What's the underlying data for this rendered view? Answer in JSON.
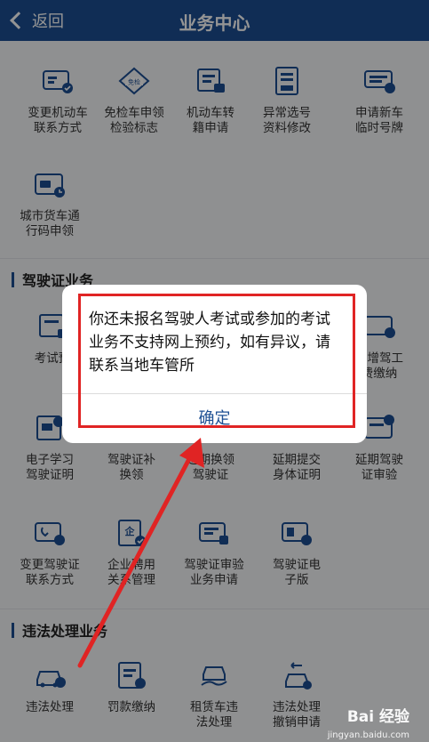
{
  "header": {
    "back_label": "返回",
    "title": "业务中心"
  },
  "vehicle": {
    "tiles": [
      {
        "l1": "变更机动车",
        "l2": "联系方式",
        "icon": "card-contact-icon"
      },
      {
        "l1": "免检车申领",
        "l2": "检验标志",
        "icon": "exempt-badge-icon",
        "badge": "免检"
      },
      {
        "l1": "机动车转",
        "l2": "籍申请",
        "icon": "vehicle-transfer-icon"
      },
      {
        "l1": "异常选号",
        "l2": "资料修改",
        "icon": "number-edit-icon"
      },
      {
        "l1": "申请新车",
        "l2": "临时号牌",
        "icon": "temp-plate-icon"
      },
      {
        "l1": "城市货车通",
        "l2": "行码申领",
        "icon": "truck-pass-icon"
      }
    ]
  },
  "license": {
    "title": "驾驶证业务",
    "tiles": [
      {
        "l1": "考试预",
        "l2": "",
        "icon": "exam-icon"
      },
      {
        "l1": "",
        "l2": "",
        "icon": "hidden-icon"
      },
      {
        "l1": "",
        "l2": "",
        "icon": "hidden-icon"
      },
      {
        "l1": "",
        "l2": "",
        "icon": "hidden-icon"
      },
      {
        "l1": "学增驾工",
        "l2": "费缴纳",
        "icon": "fee-card-icon"
      },
      {
        "l1": "电子学习",
        "l2": "驾驶证明",
        "icon": "e-study-icon"
      },
      {
        "l1": "驾驶证补",
        "l2": "换领",
        "icon": "license-replace-icon"
      },
      {
        "l1": "延期换领",
        "l2": "驾驶证",
        "icon": "license-extend-icon"
      },
      {
        "l1": "延期提交",
        "l2": "身体证明",
        "icon": "health-doc-icon"
      },
      {
        "l1": "延期驾驶",
        "l2": "证审验",
        "icon": "license-review-icon"
      },
      {
        "l1": "变更驾驶证",
        "l2": "联系方式",
        "icon": "license-contact-icon"
      },
      {
        "l1": "企业聘用",
        "l2": "关系管理",
        "icon": "enterprise-icon",
        "badge": "企"
      },
      {
        "l1": "驾驶证审验",
        "l2": "业务申请",
        "icon": "review-apply-icon"
      },
      {
        "l1": "驾驶证电",
        "l2": "子版",
        "icon": "e-license-icon"
      }
    ]
  },
  "violation": {
    "title": "违法处理业务",
    "tiles": [
      {
        "l1": "违法处理",
        "l2": "",
        "icon": "car-violation-icon"
      },
      {
        "l1": "罚款缴纳",
        "l2": "",
        "icon": "fine-pay-icon"
      },
      {
        "l1": "租赁车违",
        "l2": "法处理",
        "icon": "rental-car-icon"
      },
      {
        "l1": "违法处理",
        "l2": "撤销申请",
        "icon": "revoke-icon"
      }
    ]
  },
  "dialog": {
    "message": "你还未报名驾驶人考试或参加的考试业务不支持网上预约，如有异议，请联系当地车管所",
    "confirm": "确定"
  },
  "watermark": {
    "brand": "Bai 经验",
    "sub": "jingyan.baidu.com"
  },
  "colors": {
    "header": "#1d4f93",
    "icon_blue": "#1d4f93",
    "highlight": "#e02424"
  }
}
